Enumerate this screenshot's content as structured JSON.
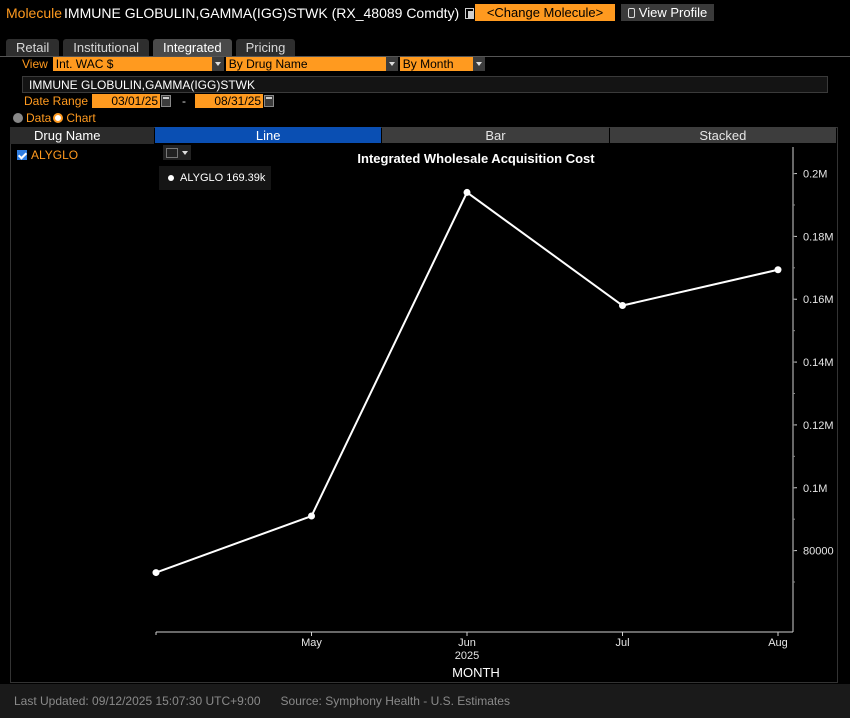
{
  "header": {
    "label": "Molecule",
    "title": "IMMUNE GLOBULIN,GAMMA(IGG)STWK (RX_48089 Comdty)",
    "change_button": "<Change Molecule>",
    "profile_button": "View Profile"
  },
  "tabs": [
    "Retail",
    "Institutional",
    "Integrated",
    "Pricing"
  ],
  "active_tab": "Integrated",
  "controls": {
    "view_label": "View",
    "view_value": "Int. WAC $",
    "group_value": "By Drug Name",
    "period_value": "By Month",
    "molecule_name": "IMMUNE GLOBULIN,GAMMA(IGG)STWK",
    "date_range_label": "Date Range",
    "date_start": "03/01/25",
    "date_sep": "-",
    "date_end": "08/31/25",
    "radio_data": "Data",
    "radio_chart": "Chart"
  },
  "list": {
    "column_header": "Drug Name",
    "items": [
      {
        "label": "ALYGLO",
        "checked": true
      }
    ]
  },
  "chart_tabs": [
    "Line",
    "Bar",
    "Stacked"
  ],
  "active_chart_tab": "Line",
  "legend": {
    "text": "ALYGLO 169.39k",
    "color": "#ffffff"
  },
  "icons": {
    "copy": "copy-icon",
    "profile": "profile-icon",
    "calendar": "calendar-icon",
    "chart_type": "line-chart-icon"
  },
  "chart_data": {
    "type": "line",
    "title": "Integrated Wholesale Acquisition Cost",
    "xlabel": "MONTH",
    "ylabel": "",
    "x": [
      "2025-04",
      "2025-05",
      "2025-06",
      "2025-07",
      "2025-08"
    ],
    "x_tick_labels": [
      "May",
      "Jun",
      "Jul",
      "Aug"
    ],
    "x_tick_sublabel": "2025",
    "y_ticks": [
      "80000",
      "0.1M",
      "0.12M",
      "0.14M",
      "0.16M",
      "0.18M",
      "0.2M"
    ],
    "y_tick_values": [
      80000,
      100000,
      120000,
      140000,
      160000,
      180000,
      200000
    ],
    "ylim": [
      63000,
      204000
    ],
    "series": [
      {
        "name": "ALYGLO",
        "color": "#ffffff",
        "values": [
          73000,
          91000,
          194000,
          158000,
          169390
        ]
      }
    ],
    "grid": false,
    "legend_position": "top-left"
  },
  "footer": {
    "last_updated": "Last Updated: 09/12/2025 15:07:30 UTC+9:00",
    "source": "Source: Symphony Health - U.S. Estimates"
  },
  "colors": {
    "accent": "#ff9a1f",
    "active_tab": "#0a4fb3",
    "background": "#000000"
  }
}
